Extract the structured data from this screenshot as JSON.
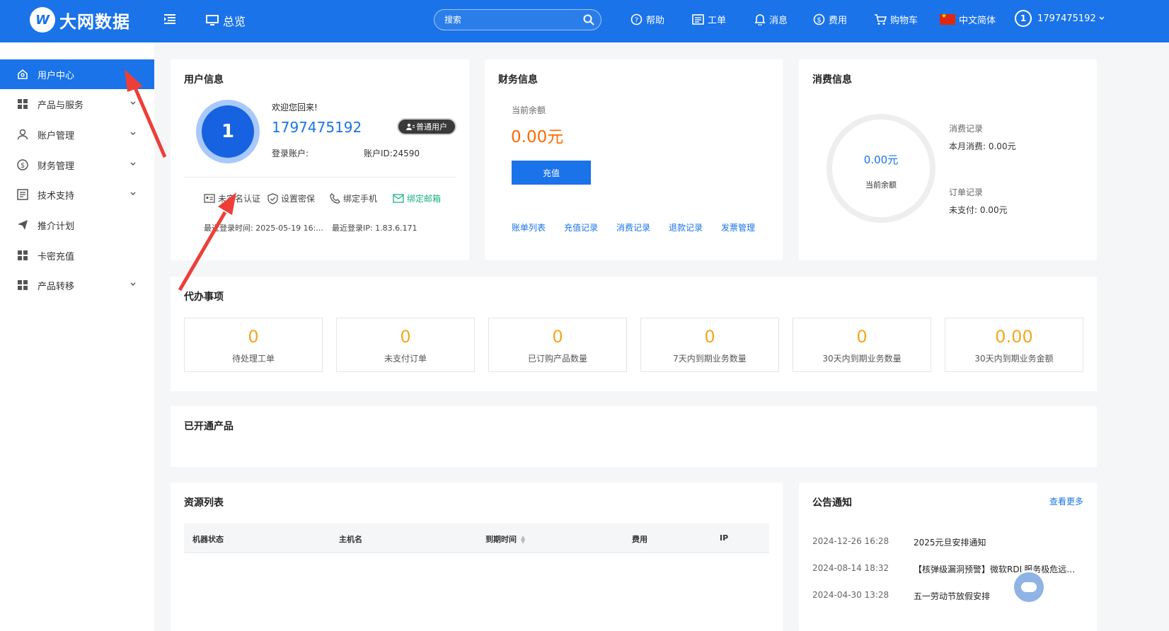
{
  "header": {
    "logo_text": "大网数据",
    "overview_label": "总览",
    "search_placeholder": "搜索",
    "nav": [
      {
        "label": "帮助",
        "icon": "help-icon"
      },
      {
        "label": "工单",
        "icon": "ticket-icon"
      },
      {
        "label": "消息",
        "icon": "bell-icon"
      },
      {
        "label": "费用",
        "icon": "money-icon"
      },
      {
        "label": "购物车",
        "icon": "cart-icon"
      },
      {
        "label": "中文简体",
        "icon": "flag-cn-icon"
      }
    ],
    "user_avatar_text": "1",
    "user_label": "1797475192"
  },
  "sidebar": {
    "items": [
      {
        "label": "用户中心",
        "icon": "home-icon",
        "active": true
      },
      {
        "label": "产品与服务",
        "icon": "grid-icon"
      },
      {
        "label": "账户管理",
        "icon": "user-icon"
      },
      {
        "label": "财务管理",
        "icon": "dollar-icon"
      },
      {
        "label": "技术支持",
        "icon": "doc-icon"
      },
      {
        "label": "推介计划",
        "icon": "send-icon"
      },
      {
        "label": "卡密充值",
        "icon": "grid-icon"
      },
      {
        "label": "产品转移",
        "icon": "grid-icon"
      }
    ]
  },
  "user_info": {
    "title": "用户信息",
    "avatar_text": "1",
    "welcome": "欢迎您回来!",
    "username": "1797475192",
    "badge": "普通用户",
    "login_account_label": "登录账户:",
    "account_id": "账户ID:24590",
    "verify": {
      "realname": "未实名认证",
      "security": "设置密保",
      "phone": "绑定手机",
      "email": "绑定邮箱"
    },
    "last_login": "最近登录时间:  2025-05-19 16:...",
    "last_ip": "最近登录IP:  1.83.6.171"
  },
  "finance": {
    "title": "财务信息",
    "balance_label": "当前余额",
    "balance_value": "0.00元",
    "recharge_button": "充值",
    "links": [
      "账单列表",
      "充值记录",
      "消费记录",
      "退款记录",
      "发票管理"
    ]
  },
  "consumption": {
    "title": "消费信息",
    "ring_value": "0.00元",
    "ring_label": "当前余额",
    "record_label": "消费记录",
    "month_consume": "本月消费:  0.00元",
    "order_label": "订单记录",
    "unpaid": "未支付:  0.00元"
  },
  "todo": {
    "title": "代办事项",
    "items": [
      {
        "value": "0",
        "label": "待处理工单"
      },
      {
        "value": "0",
        "label": "未支付订单"
      },
      {
        "value": "0",
        "label": "已订购产品数量"
      },
      {
        "value": "0",
        "label": "7天内到期业务数量"
      },
      {
        "value": "0",
        "label": "30天内到期业务数量"
      },
      {
        "value": "0.00",
        "label": "30天内到期业务金额"
      }
    ]
  },
  "products": {
    "title": "已开通产品"
  },
  "resources": {
    "title": "资源列表",
    "columns": [
      "机器状态",
      "主机名",
      "到期时间",
      "费用",
      "IP"
    ]
  },
  "notices": {
    "title": "公告通知",
    "more": "查看更多",
    "items": [
      {
        "date": "2024-12-26 16:28",
        "title": "2025元旦安排通知"
      },
      {
        "date": "2024-08-14 18:32",
        "title": "【核弹级漏洞预警】微软RDL服务极危远程代码执行漏洞"
      },
      {
        "date": "2024-04-30 13:28",
        "title": "五一劳动节放假安排"
      }
    ]
  },
  "colors": {
    "primary": "#1a73e8",
    "balance": "#ff6a00",
    "todo_number": "#f5a623",
    "verified_green": "#19b27b",
    "annotation_arrow": "#ee3e38"
  }
}
